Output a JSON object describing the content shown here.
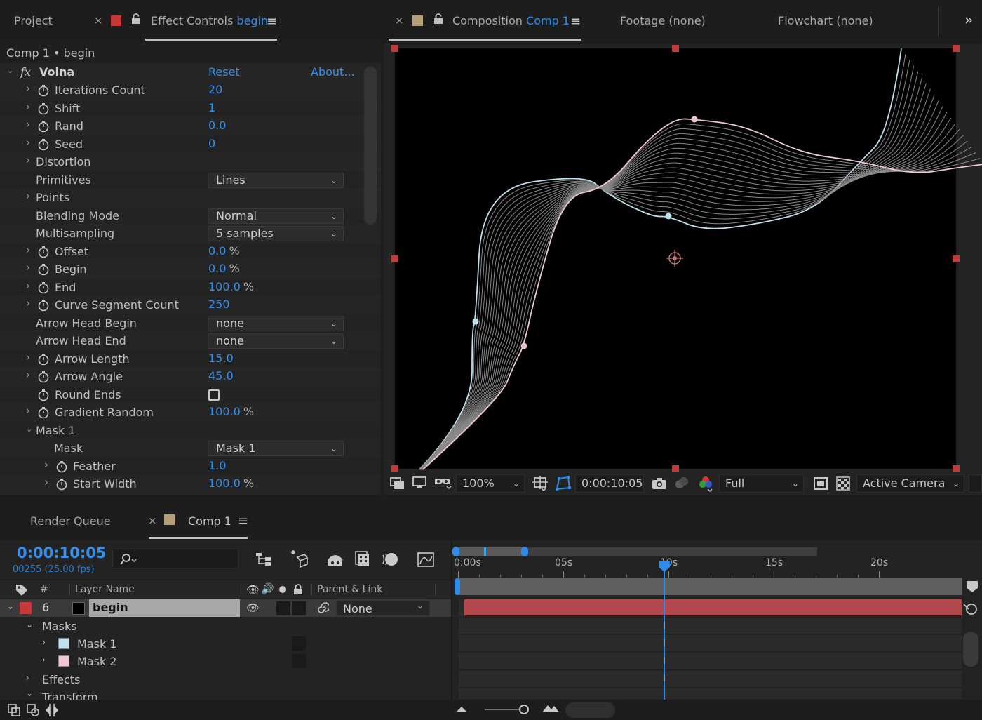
{
  "left_panel": {
    "tab_project": "Project",
    "tab_effect_controls": "Effect Controls",
    "tab_effect_layer": "begin",
    "subtitle": "Comp 1 • begin",
    "effect": {
      "fx": "fx",
      "name": "Volna",
      "reset": "Reset",
      "about": "About..."
    },
    "props": [
      {
        "label": "Iterations Count",
        "value": "20"
      },
      {
        "label": "Shift",
        "value": "1"
      },
      {
        "label": "Rand",
        "value": "0.0"
      },
      {
        "label": "Seed",
        "value": "0"
      },
      {
        "label": "Distortion"
      },
      {
        "label": "Primitives",
        "dropdown": "Lines"
      },
      {
        "label": "Points"
      },
      {
        "label": "Blending Mode",
        "dropdown": "Normal"
      },
      {
        "label": "Multisampling",
        "dropdown": "5 samples"
      },
      {
        "label": "Offset",
        "value": "0.0",
        "unit": "%"
      },
      {
        "label": "Begin",
        "value": "0.0",
        "unit": "%"
      },
      {
        "label": "End",
        "value": "100.0",
        "unit": "%"
      },
      {
        "label": "Curve Segment Count",
        "value": "250"
      },
      {
        "label": "Arrow Head Begin",
        "dropdown": "none"
      },
      {
        "label": "Arrow Head End",
        "dropdown": "none"
      },
      {
        "label": "Arrow Length",
        "value": "15.0"
      },
      {
        "label": "Arrow Angle",
        "value": "45.0"
      },
      {
        "label": "Round Ends",
        "checked": false
      },
      {
        "label": "Gradient Random",
        "value": "100.0",
        "unit": "%"
      },
      {
        "label": "Mask 1"
      },
      {
        "label": "Mask",
        "dropdown": "Mask 1"
      },
      {
        "label": "Feather",
        "value": "1.0"
      },
      {
        "label": "Start Width",
        "value": "100.0",
        "unit": "%"
      }
    ]
  },
  "right_panel": {
    "tab_composition": "Composition",
    "tab_comp_name": "Comp 1",
    "tab_footage": "Footage",
    "tab_footage_value": "(none)",
    "tab_flowchart": "Flowchart",
    "tab_flowchart_value": "(none)",
    "more": "»",
    "viewer_bar": {
      "zoom": "100%",
      "timecode": "0:00:10:05",
      "resolution": "Full",
      "camera": "Active Camera"
    }
  },
  "timeline": {
    "tab_render_queue": "Render Queue",
    "tab_comp": "Comp 1",
    "current_time": "0:00:10:05",
    "frame_info": "00255 (25.00 fps)",
    "search_placeholder": "",
    "columns": {
      "number": "#",
      "layer_name": "Layer Name",
      "parent_link": "Parent & Link"
    },
    "ruler": [
      "0:00s",
      "05s",
      "10s",
      "15s",
      "20s"
    ],
    "layer": {
      "number": "6",
      "name": "begin",
      "parent": "None"
    },
    "tree": {
      "masks": "Masks",
      "mask1": "Mask 1",
      "mask2": "Mask 2",
      "effects": "Effects",
      "transform": "Transform"
    },
    "playhead_fraction": 0.4083
  },
  "colors": {
    "accent_blue": "#2d8ceb",
    "label_red": "#c43a3a",
    "comp_swatch": "#b5a07a",
    "mask1_color": "#bfe3ee",
    "mask2_color": "#f0c8d4",
    "layer_bar": "#b0484c"
  }
}
